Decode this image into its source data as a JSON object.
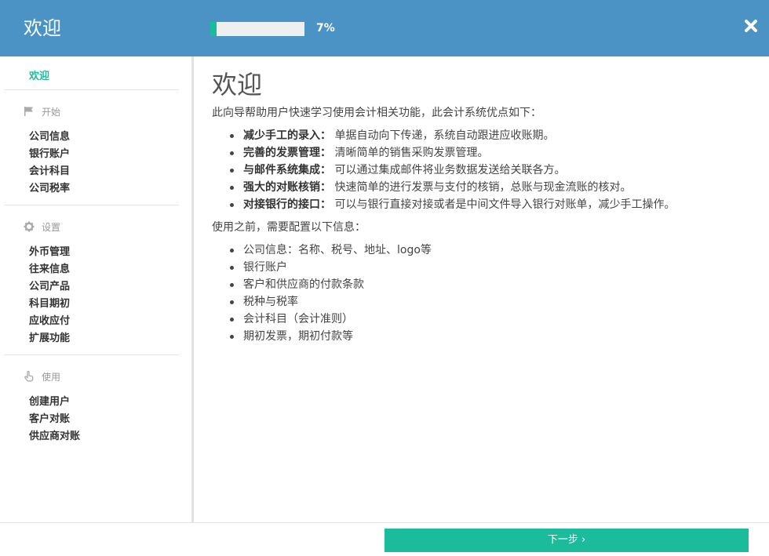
{
  "header": {
    "title": "欢迎",
    "progress_percent": 7,
    "progress_label": "7%",
    "close_icon": "close-icon"
  },
  "sidebar": {
    "welcome": "欢迎",
    "sections": [
      {
        "icon": "flag-icon",
        "label": "开始",
        "items": [
          "公司信息",
          "银行账户",
          "会计科目",
          "公司税率"
        ]
      },
      {
        "icon": "gear-icon",
        "label": "设置",
        "items": [
          "外币管理",
          "往来信息",
          "公司产品",
          "科目期初",
          "应收应付",
          "扩展功能"
        ]
      },
      {
        "icon": "hand-pointer-icon",
        "label": "使用",
        "items": [
          "创建用户",
          "客户对账",
          "供应商对账"
        ]
      }
    ]
  },
  "main": {
    "title": "欢迎",
    "intro": "此向导帮助用户快速学习使用会计相关功能，此会计系统优点如下：",
    "features": [
      {
        "term": "减少手工的录入：",
        "desc": "单据自动向下传递，系统自动跟进应收账期。"
      },
      {
        "term": "完善的发票管理：",
        "desc": "清晰简单的销售采购发票管理。"
      },
      {
        "term": "与邮件系统集成：",
        "desc": "可以通过集成邮件将业务数据发送给关联各方。"
      },
      {
        "term": "强大的对账核销：",
        "desc": "快速简单的进行发票与支付的核销，总账与现金流账的核对。"
      },
      {
        "term": "对接银行的接口：",
        "desc": "可以与银行直接对接或者是中间文件导入银行对账单，减少手工操作。"
      }
    ],
    "before_text": "使用之前，需要配置以下信息：",
    "prerequisites": [
      "公司信息：名称、税号、地址、logo等",
      "银行账户",
      "客户和供应商的付款条款",
      "税种与税率",
      "会计科目（会计准则）",
      "期初发票，期初付款等"
    ]
  },
  "footer": {
    "next_label": "下一步 ›"
  },
  "colors": {
    "header_bg": "#4a93c4",
    "accent": "#1bbc9b"
  }
}
